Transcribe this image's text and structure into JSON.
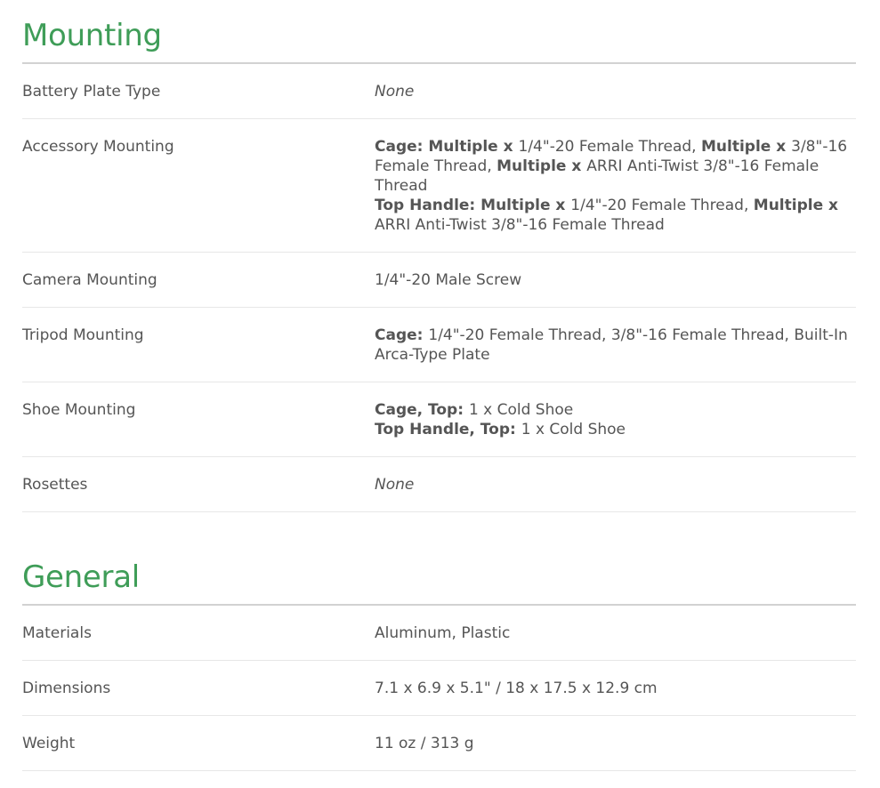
{
  "sections": [
    {
      "title": "Mounting",
      "rows": [
        {
          "label": "Battery Plate Type",
          "value": "None"
        },
        {
          "label": "Accessory Mounting",
          "lines": [
            {
              "parts": [
                {
                  "b": "Cage: "
                },
                {
                  "b": "Multiple x "
                },
                {
                  "t": "1/4\"-20 Female Thread, "
                },
                {
                  "b": "Multiple x "
                },
                {
                  "t": "3/8\"-16 Female Thread, "
                },
                {
                  "b": "Multiple x "
                },
                {
                  "t": "ARRI Anti-Twist 3/8\"-16 Female Thread"
                }
              ]
            },
            {
              "parts": [
                {
                  "b": "Top Handle: "
                },
                {
                  "b": "Multiple x "
                },
                {
                  "t": "1/4\"-20 Female Thread, "
                },
                {
                  "b": "Multiple x "
                },
                {
                  "t": "ARRI Anti-Twist 3/8\"-16 Female Thread"
                }
              ]
            }
          ]
        },
        {
          "label": "Camera Mounting",
          "value": "1/4\"-20 Male Screw"
        },
        {
          "label": "Tripod Mounting",
          "lines": [
            {
              "parts": [
                {
                  "b": "Cage: "
                },
                {
                  "t": "1/4\"-20 Female Thread, 3/8\"-16 Female Thread, Built-In Arca-Type Plate"
                }
              ]
            }
          ]
        },
        {
          "label": "Shoe Mounting",
          "lines": [
            {
              "parts": [
                {
                  "b": "Cage, Top: "
                },
                {
                  "t": "1 x Cold Shoe"
                }
              ]
            },
            {
              "parts": [
                {
                  "b": "Top Handle, Top: "
                },
                {
                  "t": "1 x Cold Shoe"
                }
              ]
            }
          ]
        },
        {
          "label": "Rosettes",
          "value": "None"
        }
      ]
    },
    {
      "title": "General",
      "rows": [
        {
          "label": "Materials",
          "value": "Aluminum, Plastic"
        },
        {
          "label": "Dimensions",
          "value": "7.1 x 6.9 x 5.1\" / 18 x 17.5 x 12.9 cm"
        },
        {
          "label": "Weight",
          "value": "11 oz / 313 g"
        }
      ]
    }
  ],
  "colors": {
    "heading": "#3f9d58",
    "text": "#555555",
    "heading_rule": "#d2d2d2",
    "row_rule": "#e7e7e7"
  }
}
